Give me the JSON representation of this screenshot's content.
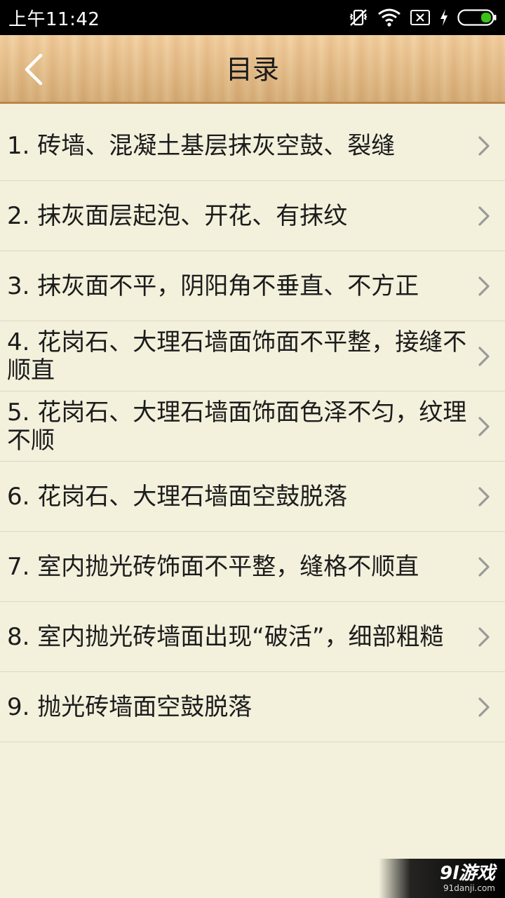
{
  "status_bar": {
    "time": "上午11:42",
    "icons": [
      "vibrate-off-icon",
      "wifi-icon",
      "sim-none-icon",
      "charging-icon",
      "battery-icon"
    ]
  },
  "header": {
    "title": "目录",
    "back_icon": "chevron-left-icon"
  },
  "toc": {
    "items": [
      {
        "label": "1. 砖墙、混凝土基层抹灰空鼓、裂缝"
      },
      {
        "label": "2. 抹灰面层起泡、开花、有抹纹"
      },
      {
        "label": "3. 抹灰面不平，阴阳角不垂直、不方正"
      },
      {
        "label": "4. 花岗石、大理石墙面饰面不平整，接缝不顺直"
      },
      {
        "label": "5. 花岗石、大理石墙面饰面色泽不匀，纹理不顺"
      },
      {
        "label": "6. 花岗石、大理石墙面空鼓脱落"
      },
      {
        "label": "7. 室内抛光砖饰面不平整，缝格不顺直"
      },
      {
        "label": "8. 室内抛光砖墙面出现“破活”，细部粗糙"
      },
      {
        "label": "9. 抛光砖墙面空鼓脱落"
      }
    ],
    "chevron_icon": "chevron-right-icon"
  },
  "watermark": {
    "main": "9l游戏",
    "sub": "91danji.com"
  },
  "colors": {
    "background": "#f3f0dc",
    "header_wood": "#ecc086",
    "divider": "#ddd9c3",
    "battery_green": "#3bc21a"
  }
}
